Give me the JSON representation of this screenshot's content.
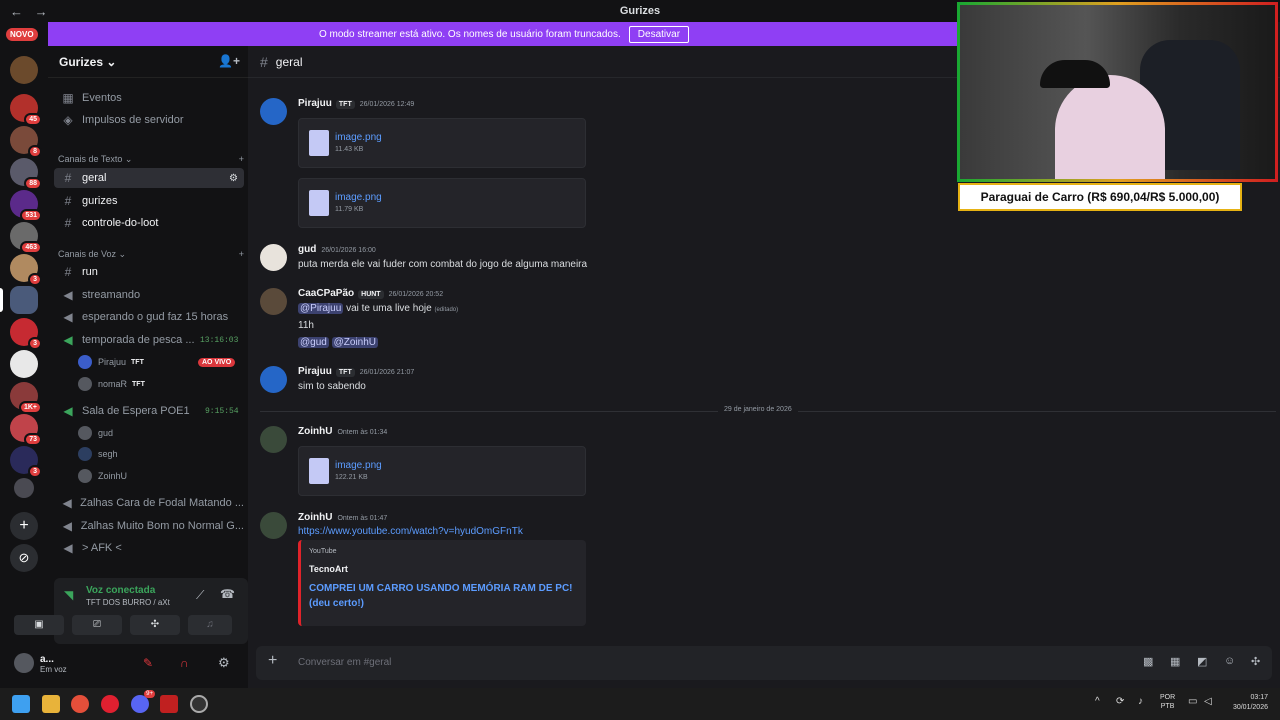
{
  "window": {
    "title": "Gurizes",
    "nav": "← →"
  },
  "streamer": {
    "message": "O modo streamer está ativo. Os nomes de usuário foram truncados.",
    "button": "Desativar"
  },
  "guilds": {
    "new_label": "NOVO",
    "badges": [
      "45",
      "8",
      "88",
      "531",
      "463",
      "3",
      "3",
      "1K+",
      "73",
      "3"
    ]
  },
  "server": {
    "name": "Gurizes ⌄"
  },
  "sidebar": {
    "events": "Eventos",
    "boosts": "Impulsos de servidor",
    "text_category": "Canais de Texto ⌄",
    "text_channels": [
      "geral",
      "gurizes",
      "controle-do-loot"
    ],
    "voice_category": "Canais de Voz ⌄",
    "voice_channels": [
      {
        "name": "run"
      },
      {
        "name": "streamando"
      },
      {
        "name": "esperando o gud faz 15 horas"
      },
      {
        "name": "temporada de pesca ...",
        "timer": "13:16:03"
      },
      {
        "name": "Sala de Espera POE1",
        "timer": "9:15:54"
      },
      {
        "name": "Zalhas Cara de Fodal Matando ..."
      },
      {
        "name": "Zalhas Muito Bom no Normal G..."
      },
      {
        "name": "> AFK <"
      }
    ],
    "voice_users_1": [
      {
        "name": "Pirajuu",
        "tag": "TFT"
      },
      {
        "name": "nomaR",
        "tag": "TFT"
      }
    ],
    "live_badge": "AO VIVO",
    "voice_users_2": [
      "gud",
      "segh",
      "ZoinhU"
    ]
  },
  "voicepanel": {
    "title": "Voz conectada",
    "subtitle": "TFT DOS BURRO / aXt"
  },
  "userpanel": {
    "name": "a...",
    "status": "Em voz"
  },
  "channel": {
    "name": "geral"
  },
  "messages": [
    {
      "author": "Pirajuu",
      "tag": "TFT",
      "time": "26/01/2026 12:49",
      "files": [
        {
          "name": "image.png",
          "size": "11.43 KB"
        },
        {
          "name": "image.png",
          "size": "11.79 KB"
        }
      ]
    },
    {
      "author": "gud",
      "time": "26/01/2026 16:00",
      "text": "puta merda ele vai fuder com combat do jogo de alguma maneira"
    },
    {
      "author": "CaaCPaPão",
      "tag": "HUNT",
      "time": "26/01/2026 20:52",
      "mention1": "@Pirajuu",
      "text1": "vai te uma live hoje",
      "edited": "(editado)",
      "text2": "11h",
      "mention2": "@gud",
      "mention3": "@ZoinhU"
    },
    {
      "author": "Pirajuu",
      "tag": "TFT",
      "time": "26/01/2026 21:07",
      "text": "sim to sabendo"
    },
    {
      "author": "ZoinhU",
      "time": "Ontem às 01:34",
      "file": {
        "name": "image.png",
        "size": "122.21 KB"
      }
    },
    {
      "author": "ZoinhU",
      "time": "Ontem às 01:47",
      "link": "https://www.youtube.com/watch?v=hyudOmGFnTk",
      "embed": {
        "provider": "YouTube",
        "author": "TecnoArt",
        "title1": "COMPREI UM CARRO USANDO MEMÓRIA RAM DE PC!",
        "title2": "(deu certo!)"
      }
    }
  ],
  "divider": "29 de janeiro de 2026",
  "composer": {
    "placeholder": "Conversar em #geral"
  },
  "overlay": {
    "command": "Paraguai de Carro (R$ 690,04/R$ 5.000,00)"
  },
  "taskbar": {
    "lang1": "POR",
    "lang2": "PTB",
    "time": "03:17",
    "date": "30/01/2026",
    "badge": "9+"
  }
}
